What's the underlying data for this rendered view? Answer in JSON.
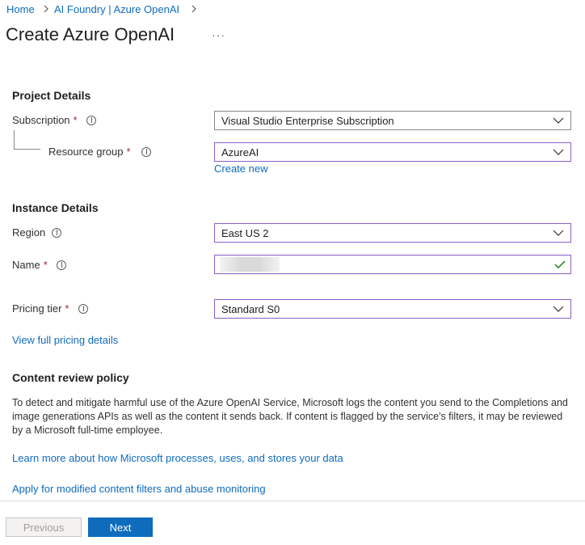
{
  "breadcrumb": {
    "items": [
      "Home",
      "AI Foundry | Azure OpenAI"
    ]
  },
  "page": {
    "title": "Create Azure OpenAI",
    "more": "···"
  },
  "project": {
    "heading": "Project Details",
    "subscription_label": "Subscription",
    "subscription_value": "Visual Studio Enterprise Subscription",
    "resource_group_label": "Resource group",
    "resource_group_value": "AzureAI",
    "create_new": "Create new"
  },
  "instance": {
    "heading": "Instance Details",
    "region_label": "Region",
    "region_value": "East US 2",
    "name_label": "Name",
    "name_value": "",
    "pricing_label": "Pricing tier",
    "pricing_value": "Standard S0",
    "pricing_link": "View full pricing details"
  },
  "content_review": {
    "heading": "Content review policy",
    "description": "To detect and mitigate harmful use of the Azure OpenAI Service, Microsoft logs the content you send to the Completions and image generations APIs as well as the content it sends back. If content is flagged by the service's filters, it may be reviewed by a Microsoft full-time employee.",
    "learn_more": "Learn more about how Microsoft processes, uses, and stores your data",
    "apply_link": "Apply for modified content filters and abuse monitoring"
  },
  "footer": {
    "previous": "Previous",
    "next": "Next"
  },
  "required_marker": "*",
  "colors": {
    "link": "#0f6cbd",
    "primary": "#0f6cbd",
    "focus_border": "#8661c5",
    "required": "#a4262c",
    "valid": "#107c10"
  }
}
